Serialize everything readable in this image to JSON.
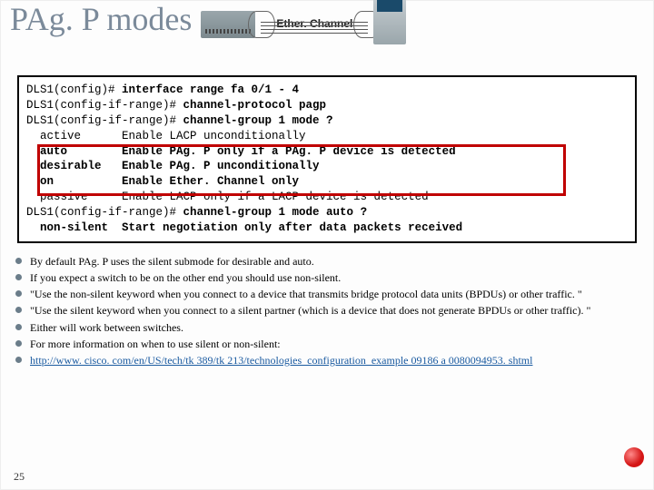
{
  "header": {
    "title": "PAg. P modes",
    "link_label": "Ether. Channel"
  },
  "code": {
    "l1a": "DLS1(config)# ",
    "l1b": "interface range fa 0/1 - 4",
    "l2a": "DLS1(config-if-range)# ",
    "l2b": "channel-protocol pagp",
    "l3a": "DLS1(config-if-range)# ",
    "l3b": "channel-group 1 mode ?",
    "l4": "  active      Enable LACP unconditionally",
    "l5": "  auto        Enable PAg. P only if a PAg. P device is detected",
    "l6": "  desirable   Enable PAg. P unconditionally",
    "l7": "  on          Enable Ether. Channel only",
    "l8": "  passive     Enable LACP only if a LACP device is detected",
    "l9a": "DLS1(config-if-range)# ",
    "l9b": "channel-group 1 mode auto ?",
    "l10": "  non-silent  Start negotiation only after data packets received"
  },
  "bullets": {
    "b1": "By default PAg. P uses the silent submode for desirable and auto.",
    "b2": "If you expect a switch to be on the other end you should use non-silent.",
    "b3": "\"Use the non-silent keyword when you connect to a device that transmits bridge protocol data units (BPDUs) or other traffic. \"",
    "b4": "\"Use the silent keyword when you connect to a silent partner (which is a device that does not generate BPDUs or other traffic). \"",
    "b5": "Either will work between switches.",
    "b6": "For more information on when to use silent or non-silent:",
    "b7_url": "http://www. cisco. com/en/US/tech/tk 389/tk 213/technologies_configuration_example 09186 a 0080094953. shtml"
  },
  "page_number": "25"
}
